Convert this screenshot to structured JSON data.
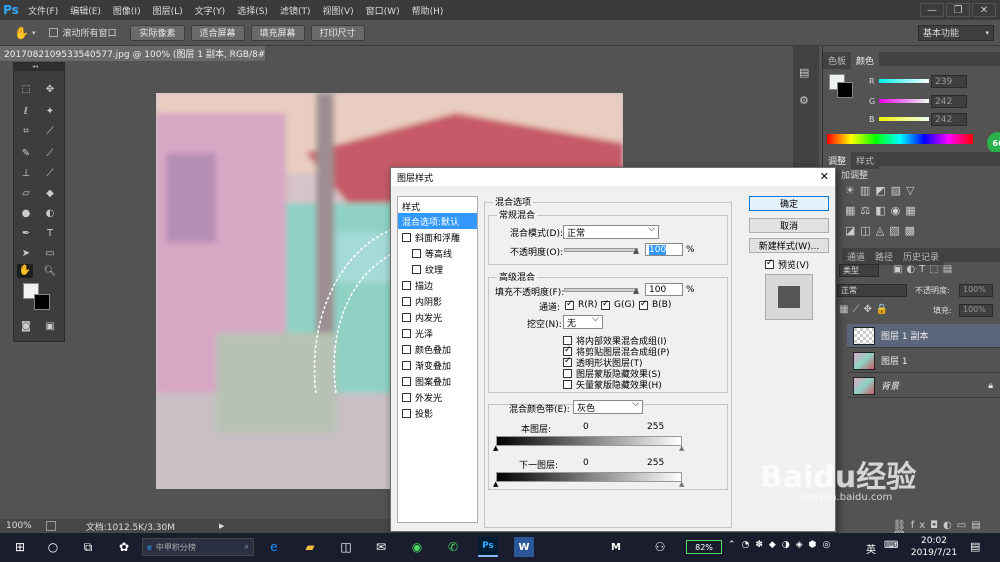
{
  "app": {
    "logo": "Ps",
    "window_controls": [
      "—",
      "❐",
      "✕"
    ]
  },
  "menu": [
    "文件(F)",
    "编辑(E)",
    "图像(I)",
    "图层(L)",
    "文字(Y)",
    "选择(S)",
    "滤镜(T)",
    "视图(V)",
    "窗口(W)",
    "帮助(H)"
  ],
  "options": {
    "scroll_all_label": "滚动所有窗口",
    "buttons": [
      "实际像素",
      "适合屏幕",
      "填充屏幕",
      "打印尺寸"
    ],
    "workspace": "基本功能"
  },
  "document_tab": "20170821095335405​77.jpg @ 100% (图层 1 副本, RGB/8#) *",
  "status": {
    "zoom": "100%",
    "doc_info": "文档:1012.5K/3.30M"
  },
  "color_panel": {
    "tabs": [
      "色板",
      "颜色"
    ],
    "active_tab": "颜色",
    "R": "239",
    "G": "242",
    "B": "242"
  },
  "adjust_panel": {
    "tabs": [
      "调整",
      "样式"
    ],
    "title": "加调整"
  },
  "layers_panel": {
    "tabs": [
      "层",
      "通道",
      "路径",
      "历史记录"
    ],
    "kind_label": "类型",
    "mode": "正常",
    "opacity_label": "不透明度:",
    "opacity": "100%",
    "fill_label": "填充:",
    "fill": "100%",
    "layers": [
      {
        "name": "图层 1 副本",
        "selected": true
      },
      {
        "name": "图层 1",
        "selected": false
      },
      {
        "name": "背景",
        "selected": false,
        "locked": true
      }
    ]
  },
  "dialog": {
    "title": "图层样式",
    "close": "✕",
    "styles_header": "样式",
    "style_items": [
      {
        "label": "混合选项:默认",
        "checkbox": false,
        "selected": true,
        "indent": 0
      },
      {
        "label": "斜面和浮雕",
        "checkbox": true,
        "selected": false,
        "indent": 0
      },
      {
        "label": "等高线",
        "checkbox": true,
        "selected": false,
        "indent": 1
      },
      {
        "label": "纹理",
        "checkbox": true,
        "selected": false,
        "indent": 1
      },
      {
        "label": "描边",
        "checkbox": true,
        "selected": false,
        "indent": 0
      },
      {
        "label": "内阴影",
        "checkbox": true,
        "selected": false,
        "indent": 0
      },
      {
        "label": "内发光",
        "checkbox": true,
        "selected": false,
        "indent": 0
      },
      {
        "label": "光泽",
        "checkbox": true,
        "selected": false,
        "indent": 0
      },
      {
        "label": "颜色叠加",
        "checkbox": true,
        "selected": false,
        "indent": 0
      },
      {
        "label": "渐变叠加",
        "checkbox": true,
        "selected": false,
        "indent": 0
      },
      {
        "label": "图案叠加",
        "checkbox": true,
        "selected": false,
        "indent": 0
      },
      {
        "label": "外发光",
        "checkbox": true,
        "selected": false,
        "indent": 0
      },
      {
        "label": "投影",
        "checkbox": true,
        "selected": false,
        "indent": 0
      }
    ],
    "blend_options_title": "混合选项",
    "general_blend": "常规混合",
    "blend_mode_label": "混合模式(D):",
    "blend_mode": "正常",
    "opacity_label": "不透明度(O):",
    "opacity": "100",
    "percent": "%",
    "advanced_blend": "高级混合",
    "fill_opacity_label": "填充不透明度(F):",
    "fill_opacity": "100",
    "channels_label": "通道:",
    "channels": [
      "R(R)",
      "G(G)",
      "B(B)"
    ],
    "knockout_label": "挖空(N):",
    "knockout": "无",
    "advanced_options": [
      {
        "label": "将内部效果混合成组(I)",
        "checked": false
      },
      {
        "label": "将剪贴图层混合成组(P)",
        "checked": true
      },
      {
        "label": "透明形状图层(T)",
        "checked": true
      },
      {
        "label": "图层蒙版隐藏效果(S)",
        "checked": false
      },
      {
        "label": "矢量蒙版隐藏效果(H)",
        "checked": false
      }
    ],
    "blend_if_label": "混合颜色带(E):",
    "blend_if": "灰色",
    "this_layer_label": "本图层:",
    "underlying_label": "下一图层:",
    "range_min": "0",
    "range_max": "255",
    "ok": "确定",
    "cancel": "取消",
    "new_style": "新建样式(W)...",
    "preview_label": "预览(V)"
  },
  "taskbar": {
    "search_placeholder": "中甲积分榜",
    "battery": "82%",
    "ime": "英",
    "time": "20:02",
    "date": "2019/7/21",
    "badge": "66"
  },
  "watermark": {
    "text": "Baidu经验",
    "url": "jingyan.baidu.com"
  },
  "colors": {
    "accent": "#31a8ff",
    "selection": "#3399ff"
  }
}
